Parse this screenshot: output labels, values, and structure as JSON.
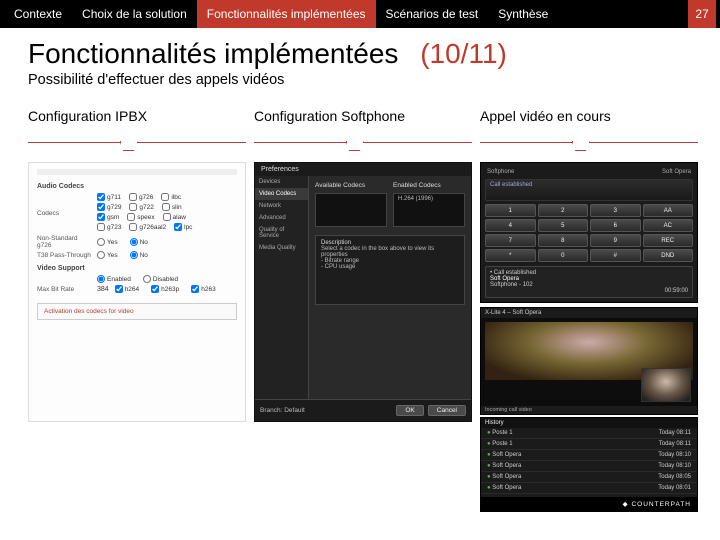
{
  "topbar": {
    "tabs": [
      {
        "label": "Contexte"
      },
      {
        "label": "Choix de la solution"
      },
      {
        "label": "Fonctionnalités implémentées",
        "active": true
      },
      {
        "label": "Scénarios de test"
      },
      {
        "label": "Synthèse"
      }
    ],
    "page_number": "27"
  },
  "title": {
    "main": "Fonctionnalités implémentées",
    "counter": "(10/11)"
  },
  "subtitle": "Possibilité d'effectuer des appels vidéos",
  "columns": [
    {
      "heading": "Configuration IPBX"
    },
    {
      "heading": "Configuration Softphone"
    },
    {
      "heading": "Appel vidéo en cours"
    }
  ],
  "ipbx": {
    "section_codecs": "Audio Codecs",
    "label_codecs": "Codecs",
    "codecs_col1": [
      "g711",
      "g729",
      "gsm",
      "g723"
    ],
    "codecs_col2": [
      "g726",
      "g722",
      "speex",
      "g726aal2"
    ],
    "codecs_col3": [
      "ilbc",
      "slin",
      "alaw",
      "lpc"
    ],
    "label_nonstd": "Non-Standard g726",
    "label_t38": "T38 Pass-Through",
    "yes": "Yes",
    "no": "No",
    "section_video": "Video Support",
    "video_enabled": "Enabled",
    "video_disabled": "Disabled",
    "label_maxbit": "Max Bit Rate",
    "maxbit_value": "384",
    "video_codecs": [
      "h264",
      "h263p",
      "h263"
    ],
    "callout": "Activation des codecs for video"
  },
  "prefs": {
    "window_title": "Preferences",
    "side": [
      "Devices",
      "Video Codecs",
      "Network",
      "Advanced",
      "Quality of Service",
      "Media Quality"
    ],
    "side_selected": 1,
    "section_available": "Available Codecs",
    "section_enabled": "Enabled Codecs",
    "enabled_codec": "H.264 (1996)",
    "desc_title": "Description",
    "desc_body": "Select a codec in the box above to view its properties",
    "desc_lines": [
      "- Bitrate range",
      "- CPU usage"
    ],
    "foot_label": "Branch: Default",
    "btn_ok": "OK",
    "btn_cancel": "Cancel"
  },
  "call": {
    "top_left": "Softphone",
    "top_right": "Soft Opera",
    "lcd_line": "Call established",
    "keys": [
      "1",
      "2",
      "3",
      "AA",
      "4",
      "5",
      "6",
      "AC",
      "7",
      "8",
      "9",
      "REC",
      "*",
      "0",
      "#",
      "DND"
    ],
    "contact_title": "• Call established",
    "contact_name": "Soft Opera",
    "contact_ext": "Softphone - 102",
    "contact_dur": "00:59:00",
    "vidwin_title": "X-Lite 4 – Soft Opera",
    "vidwin_footer": "Incoming call video",
    "history_header": "History",
    "history": [
      {
        "name": "Poste 1",
        "time": "Today 08:11"
      },
      {
        "name": "Poste 1",
        "time": "Today 08:11"
      },
      {
        "name": "Soft Opera",
        "time": "Today 08:10"
      },
      {
        "name": "Soft Opera",
        "time": "Today 08:10"
      },
      {
        "name": "Soft Opera",
        "time": "Today 08:05"
      },
      {
        "name": "Soft Opera",
        "time": "Today 08:01"
      }
    ],
    "brand": "◆ COUNTERPATH"
  }
}
